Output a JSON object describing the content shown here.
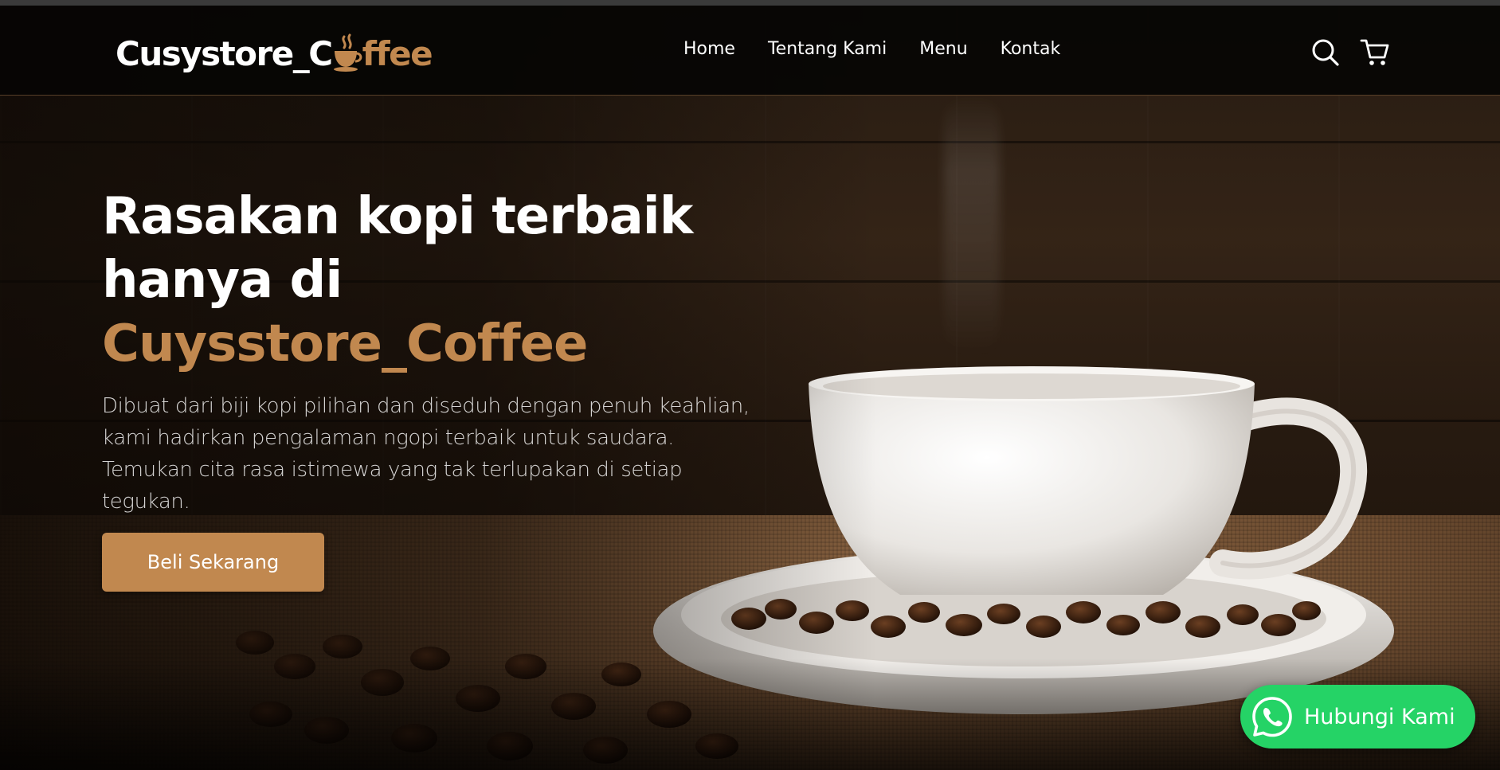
{
  "brand": {
    "logo_part1": "Cusystore_C",
    "logo_part2": "ffee",
    "logo_icon": "coffee-cup-icon",
    "accent_color": "#c1884f"
  },
  "nav": {
    "links": [
      "Home",
      "Tentang Kami",
      "Menu",
      "Kontak"
    ],
    "icons": [
      "search-icon",
      "cart-icon"
    ]
  },
  "hero": {
    "title_line1": "Rasakan kopi terbaik",
    "title_line2": "hanya di",
    "title_brand": "Cuysstore_Coffee",
    "description": "Dibuat dari biji kopi pilihan dan diseduh dengan penuh keahlian, kami hadirkan pengalaman ngopi terbaik untuk saudara. Temukan cita rasa istimewa yang tak terlupakan di setiap tegukan.",
    "cta_label": "Beli Sekarang"
  },
  "whatsapp": {
    "label": "Hubungi Kami",
    "icon": "whatsapp-icon",
    "color": "#25d366"
  }
}
